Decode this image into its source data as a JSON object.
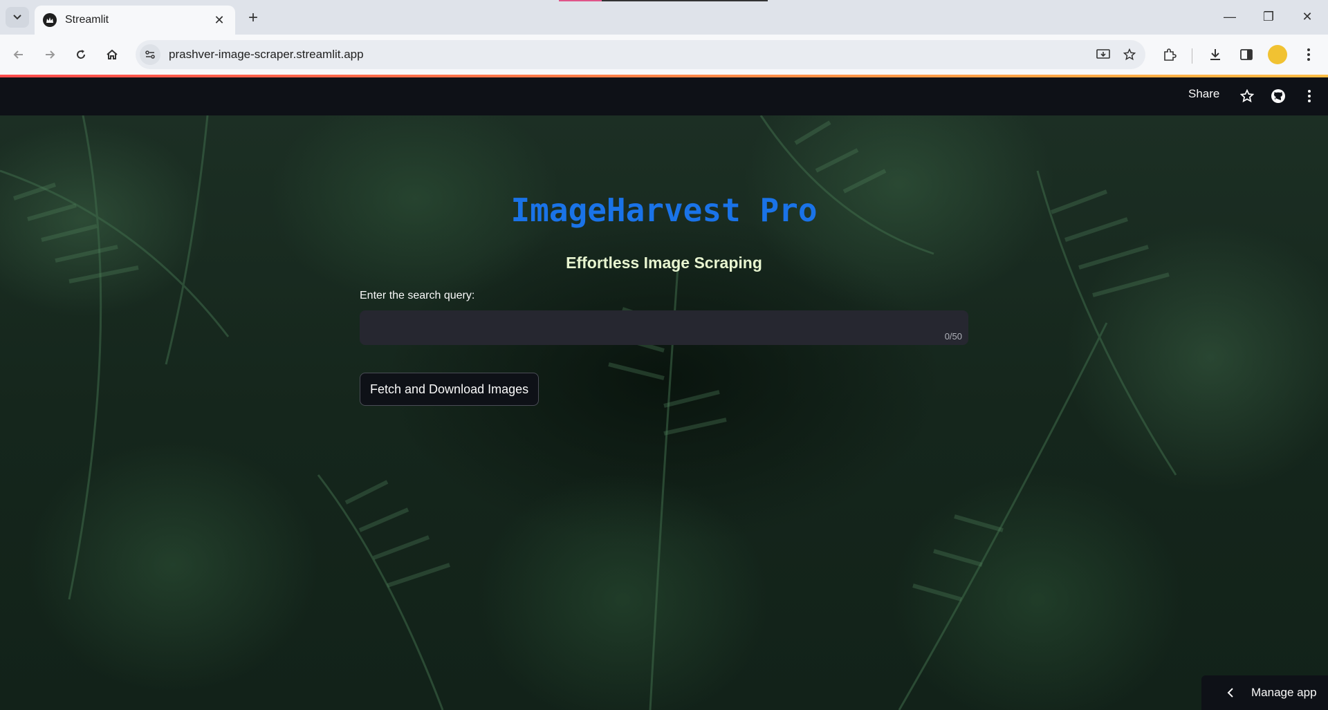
{
  "browser": {
    "tab_title": "Streamlit",
    "url": "prashver-image-scraper.streamlit.app"
  },
  "app_header": {
    "share_label": "Share"
  },
  "main": {
    "title": "ImageHarvest Pro",
    "subtitle": "Effortless Image Scraping",
    "search_label": "Enter the search query:",
    "search_value": "",
    "char_counter": "0/50",
    "fetch_button_label": "Fetch and Download Images"
  },
  "footer": {
    "manage_app_label": "Manage app"
  },
  "colors": {
    "title": "#1a73e8",
    "subtitle": "#e8f5d0",
    "header_bg": "#0e1117",
    "input_bg": "#262730"
  }
}
